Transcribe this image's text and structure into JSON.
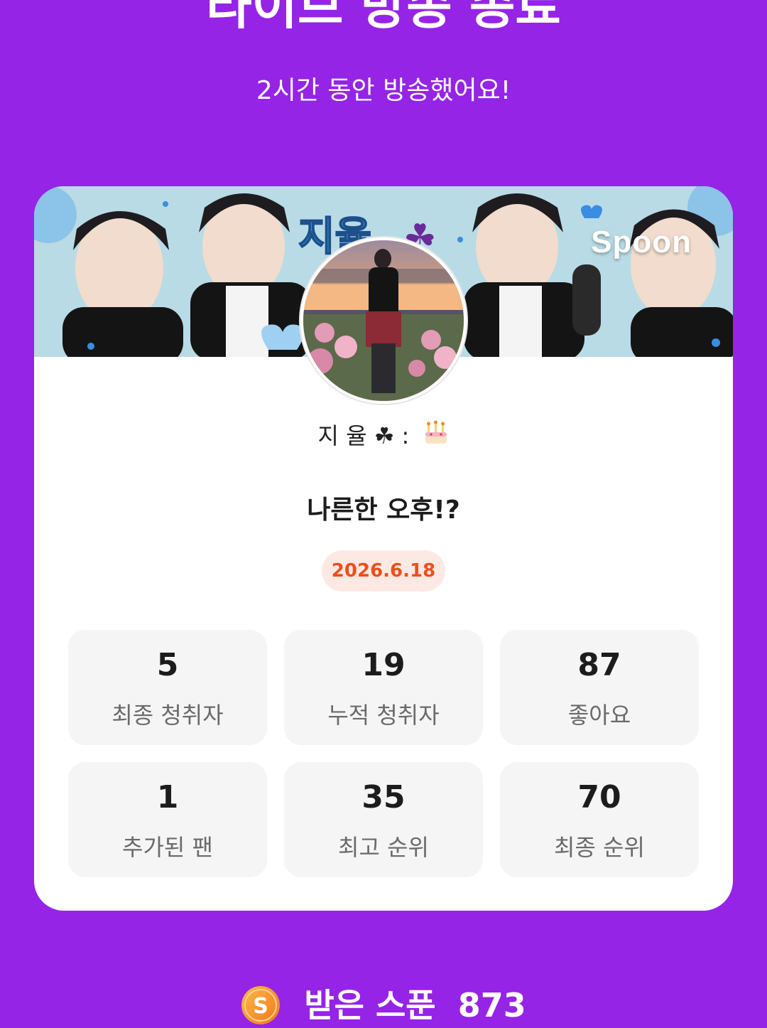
{
  "header": {
    "title": "라이브 방송 종료",
    "subtitle": "2시간 동안 방송했어요!"
  },
  "banner": {
    "brand": "Spoon"
  },
  "profile": {
    "name": "지 율 ☘︎ :"
  },
  "live": {
    "title": "나른한 오후!?",
    "date": "2026.6.18"
  },
  "stats": [
    {
      "value": "5",
      "label": "최종 청취자"
    },
    {
      "value": "19",
      "label": "누적 청취자"
    },
    {
      "value": "87",
      "label": "좋아요"
    },
    {
      "value": "1",
      "label": "추가된 팬"
    },
    {
      "value": "35",
      "label": "최고 순위"
    },
    {
      "value": "70",
      "label": "최종 순위"
    }
  ],
  "footer": {
    "label": "받은 스푼",
    "value": "873"
  },
  "colors": {
    "background": "#9524e6",
    "date_text": "#ee4f1a",
    "date_bg": "#fde9e4",
    "stat_bg": "#f5f5f5"
  }
}
